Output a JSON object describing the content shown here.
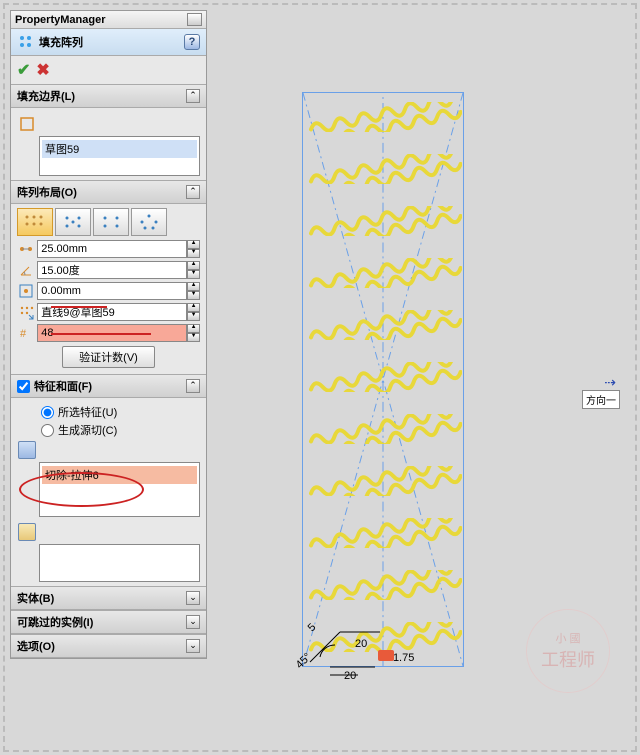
{
  "header": {
    "title": "PropertyManager"
  },
  "feature": {
    "title": "填充阵列",
    "help": "?"
  },
  "actions": {
    "ok": "✔",
    "cancel": "✖"
  },
  "sections": {
    "boundary": {
      "label": "填充边界(L)",
      "item": "草图59"
    },
    "layout": {
      "label": "阵列布局(O)",
      "spacing": "25.00mm",
      "angle": "15.00度",
      "margin": "0.00mm",
      "direction": "直线9@草图59",
      "count": "48",
      "verify": "验证计数(V)"
    },
    "feature_face": {
      "label": "特征和面(F)",
      "radio_selected": "所选特征(U)",
      "radio_seed": "生成源切(C)",
      "item": "切除-拉伸6"
    },
    "bodies": {
      "label": "实体(B)"
    },
    "skip": {
      "label": "可跳过的实例(I)"
    },
    "options": {
      "label": "选项(O)"
    }
  },
  "dims": {
    "angle": "45°",
    "d1": "20",
    "d2": "20",
    "d3": "5",
    "r": "R1.75"
  },
  "direction_label": "方向一",
  "watermark": {
    "top": "小 國",
    "bottom": "工程师"
  }
}
